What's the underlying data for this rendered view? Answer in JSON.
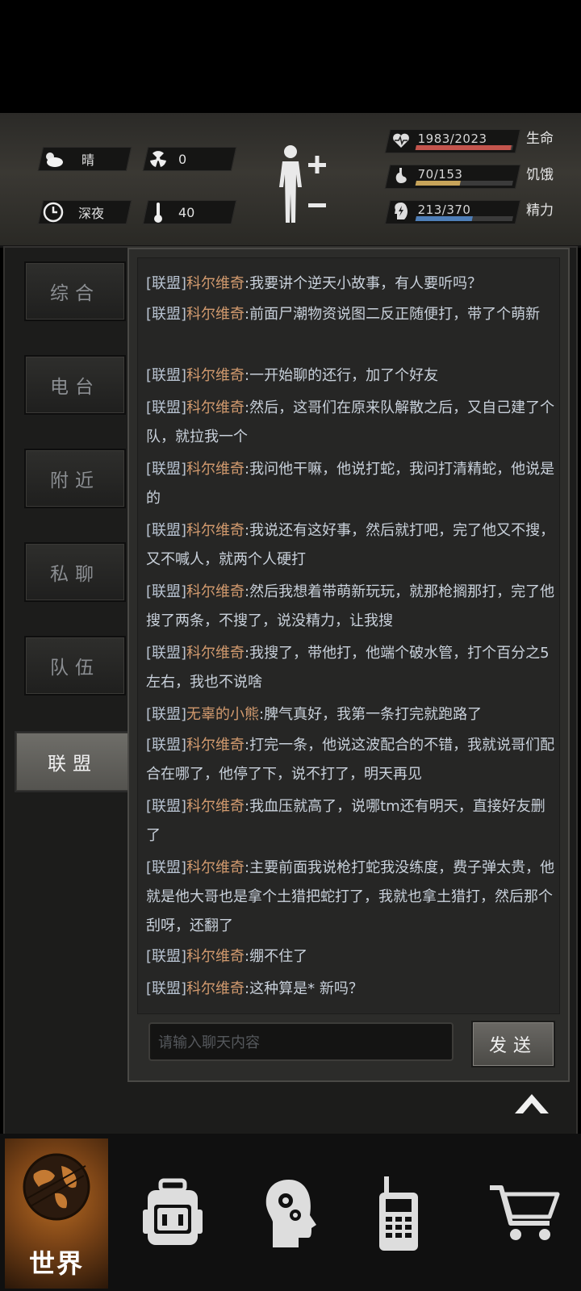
{
  "hud": {
    "weather": {
      "icon": "cloud-sun-icon",
      "label": "晴"
    },
    "radiation": {
      "icon": "radiation-icon",
      "value": "0"
    },
    "time_of_day": {
      "icon": "clock-icon",
      "label": "深夜"
    },
    "temperature": {
      "icon": "thermometer-icon",
      "value": "40"
    },
    "stats": [
      {
        "name": "生命",
        "value": "1983/2023",
        "icon": "heart-icon",
        "fill": 0.98,
        "color": "#c4554d"
      },
      {
        "name": "饥饿",
        "value": "70/153",
        "icon": "stomach-icon",
        "fill": 0.46,
        "color": "#c7a45a"
      },
      {
        "name": "精力",
        "value": "213/370",
        "icon": "brain-bolt-icon",
        "fill": 0.58,
        "color": "#4f7fb8"
      }
    ]
  },
  "tabs": [
    {
      "label": "综合",
      "active": false
    },
    {
      "label": "电台",
      "active": false
    },
    {
      "label": "附近",
      "active": false
    },
    {
      "label": "私聊",
      "active": false
    },
    {
      "label": "队伍",
      "active": false
    },
    {
      "label": "联盟",
      "active": true
    }
  ],
  "chat": {
    "messages": [
      {
        "channel": "[联盟]",
        "name": "科尔维奇",
        "text": ":我要讲个逆天小故事，有人要听吗？"
      },
      {
        "channel": "[联盟]",
        "name": "科尔维奇",
        "text": ":前面尸潮物资说图二反正随便打，带了个萌新"
      },
      {
        "channel": "[联盟]",
        "name": "科尔维奇",
        "text": ":一开始聊的还行，加了个好友"
      },
      {
        "channel": "[联盟]",
        "name": "科尔维奇",
        "text": ":然后，这哥们在原来队解散之后，又自己建了个队，就拉我一个"
      },
      {
        "channel": "[联盟]",
        "name": "科尔维奇",
        "text": ":我问他干嘛，他说打蛇，我问打清精蛇，他说是的"
      },
      {
        "channel": "[联盟]",
        "name": "科尔维奇",
        "text": ":我说还有这好事，然后就打吧，完了他又不搜，又不喊人，就两个人硬打"
      },
      {
        "channel": "[联盟]",
        "name": "科尔维奇",
        "text": ":然后我想着带萌新玩玩，就那枪搁那打，完了他搜了两条，不搜了，说没精力，让我搜"
      },
      {
        "channel": "[联盟]",
        "name": "科尔维奇",
        "text": ":我搜了，带他打，他端个破水管，打个百分之5左右，我也不说啥"
      },
      {
        "channel": "[联盟]",
        "name": "无辜的小熊",
        "text": ":脾气真好，我第一条打完就跑路了"
      },
      {
        "channel": "[联盟]",
        "name": "科尔维奇",
        "text": ":打完一条，他说这波配合的不错，我就说哥们配合在哪了，他停了下，说不打了，明天再见"
      },
      {
        "channel": "[联盟]",
        "name": "科尔维奇",
        "text": ":我血压就高了，说哪tm还有明天，直接好友删了"
      },
      {
        "channel": "[联盟]",
        "name": "科尔维奇",
        "text": ":主要前面我说枪打蛇我没练度，费子弹太贵，他就是他大哥也是拿个土猎把蛇打了，我就也拿土猎打，然后那个刮呀，还翻了"
      },
      {
        "channel": "[联盟]",
        "name": "科尔维奇",
        "text": ":绷不住了"
      },
      {
        "channel": "[联盟]",
        "name": "科尔维奇",
        "text": ":这种算是* 新吗？"
      }
    ],
    "input_placeholder": "请输入聊天内容",
    "send_label": "发送"
  },
  "bottom_nav": {
    "world_label": "世界",
    "items": [
      "globe-icon",
      "backpack-icon",
      "head-gears-icon",
      "walkie-talkie-icon",
      "cart-icon"
    ]
  }
}
